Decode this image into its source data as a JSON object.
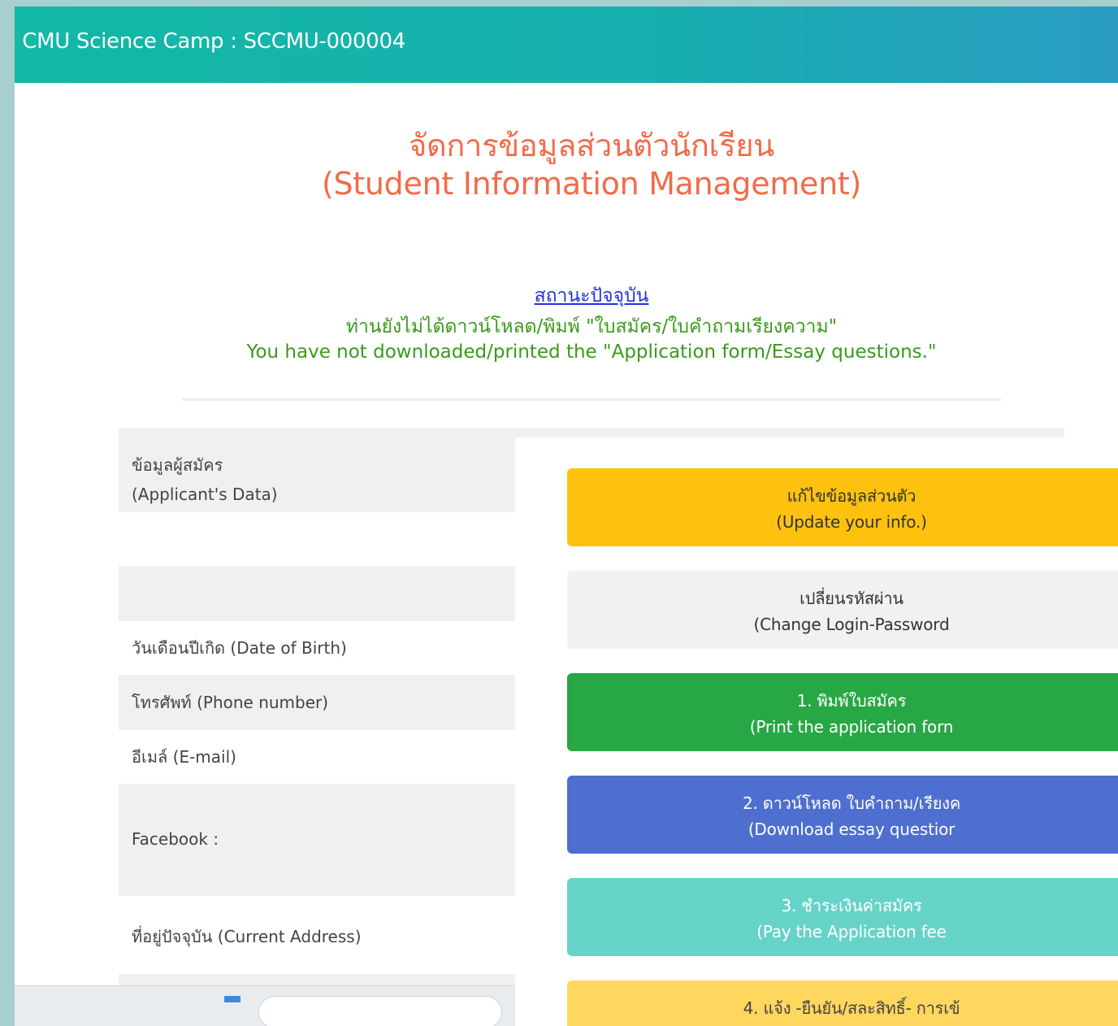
{
  "header": {
    "title": "s CMU Science Camp : SCCMU-000004"
  },
  "page": {
    "title_th": "จัดการข้อมูลส่วนตัวนักเรียน",
    "title_en": "(Student Information Management)"
  },
  "status": {
    "link": "สถานะปัจจุบัน",
    "message_th": "ท่านยังไม่ได้ดาวน์โหลด/พิมพ์ \"ใบสมัคร/ใบคำถามเรียงความ\"",
    "message_en": "You have not downloaded/printed the \"Application form/Essay questions.\""
  },
  "applicant": {
    "section_th": "ข้อมูลผู้สมัคร",
    "section_en": "(Applicant's Data)",
    "fields": [
      "วันเดือนปีเกิด (Date of Birth)",
      "โทรศัพท์ (Phone number)",
      "อีเมล์ (E-mail)",
      "Facebook :",
      "ที่อยู่ปัจจุบัน (Current Address)"
    ]
  },
  "actions": [
    {
      "th": "แก้ไขข้อมูลส่วนตัว",
      "en": "(Update your info.)",
      "color": "#fec20e"
    },
    {
      "th": "เปลี่ยนรหัสผ่าน",
      "en": "(Change Login-Password",
      "color": "#f1f1f1"
    },
    {
      "th": "1. พิมพ์ใบสมัคร",
      "en": "(Print the application forn",
      "color": "#28a745"
    },
    {
      "th": "2. ดาวน์โหลด ใบคำถาม/เรียงค",
      "en": "(Download essay questior",
      "color": "#4e6fcf"
    },
    {
      "th": "3. ชำระเงินค่าสมัคร",
      "en": "(Pay the Application fee",
      "color": "#66d3c9"
    },
    {
      "th": "4. แจ้ง -ยืนยัน/สละสิทธิ์- การเข้",
      "color": "#ffd75e"
    }
  ]
}
